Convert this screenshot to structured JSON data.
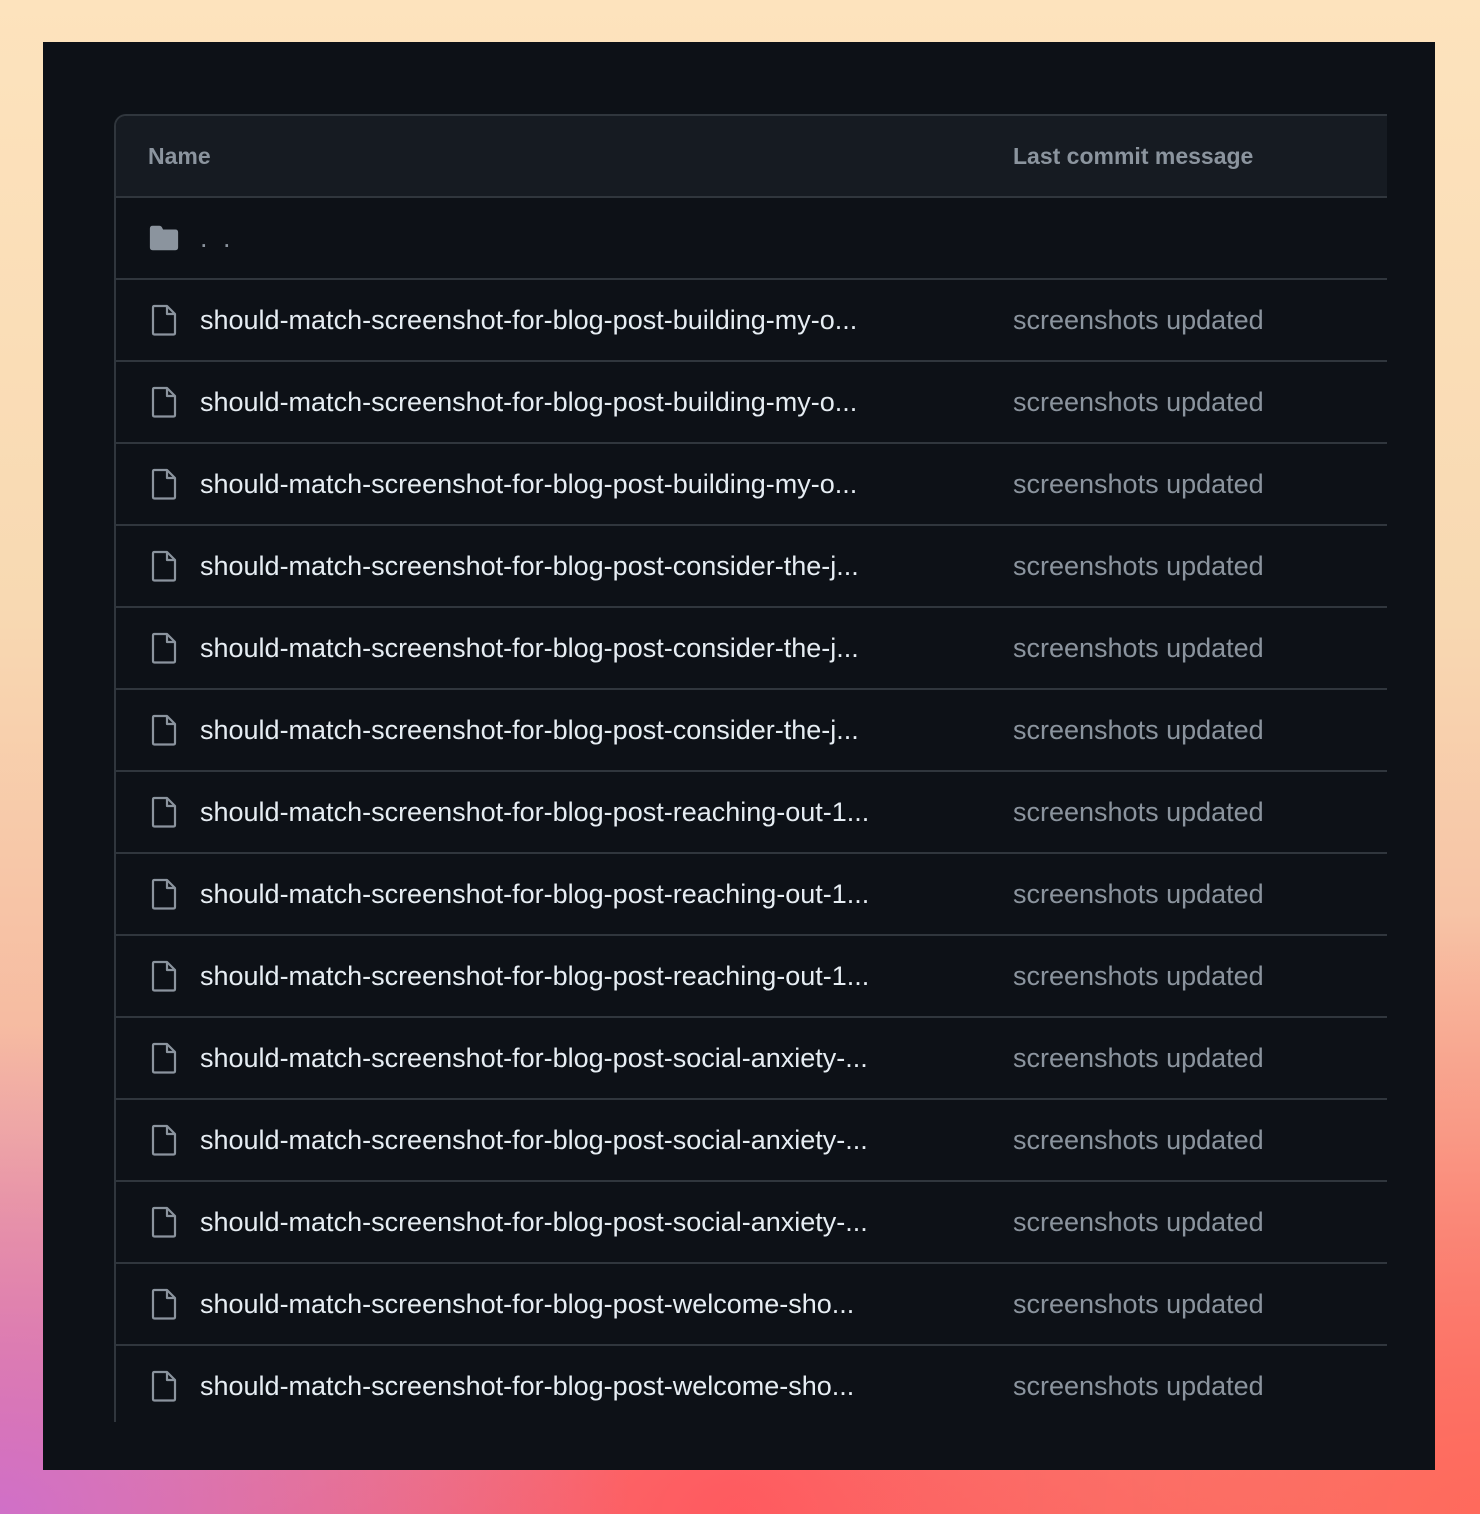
{
  "table": {
    "headers": {
      "name": "Name",
      "message": "Last commit message"
    },
    "parent_row": {
      "icon": "folder-icon",
      "label": ". ."
    },
    "rows": [
      {
        "icon": "file-icon",
        "name": "should-match-screenshot-for-blog-post-building-my-o...",
        "message": "screenshots updated"
      },
      {
        "icon": "file-icon",
        "name": "should-match-screenshot-for-blog-post-building-my-o...",
        "message": "screenshots updated"
      },
      {
        "icon": "file-icon",
        "name": "should-match-screenshot-for-blog-post-building-my-o...",
        "message": "screenshots updated"
      },
      {
        "icon": "file-icon",
        "name": "should-match-screenshot-for-blog-post-consider-the-j...",
        "message": "screenshots updated"
      },
      {
        "icon": "file-icon",
        "name": "should-match-screenshot-for-blog-post-consider-the-j...",
        "message": "screenshots updated"
      },
      {
        "icon": "file-icon",
        "name": "should-match-screenshot-for-blog-post-consider-the-j...",
        "message": "screenshots updated"
      },
      {
        "icon": "file-icon",
        "name": "should-match-screenshot-for-blog-post-reaching-out-1...",
        "message": "screenshots updated"
      },
      {
        "icon": "file-icon",
        "name": "should-match-screenshot-for-blog-post-reaching-out-1...",
        "message": "screenshots updated"
      },
      {
        "icon": "file-icon",
        "name": "should-match-screenshot-for-blog-post-reaching-out-1...",
        "message": "screenshots updated"
      },
      {
        "icon": "file-icon",
        "name": "should-match-screenshot-for-blog-post-social-anxiety-...",
        "message": "screenshots updated"
      },
      {
        "icon": "file-icon",
        "name": "should-match-screenshot-for-blog-post-social-anxiety-...",
        "message": "screenshots updated"
      },
      {
        "icon": "file-icon",
        "name": "should-match-screenshot-for-blog-post-social-anxiety-...",
        "message": "screenshots updated"
      },
      {
        "icon": "file-icon",
        "name": "should-match-screenshot-for-blog-post-welcome-sho...",
        "message": "screenshots updated"
      },
      {
        "icon": "file-icon",
        "name": "should-match-screenshot-for-blog-post-welcome-sho...",
        "message": "screenshots updated"
      }
    ]
  },
  "colors": {
    "window_bg": "#0d1117",
    "header_bg": "#161b22",
    "border": "#30363d",
    "text_primary": "#e6edf3",
    "text_muted": "#8b949e"
  }
}
